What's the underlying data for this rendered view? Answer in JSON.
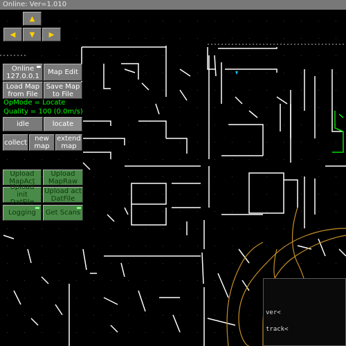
{
  "title_bar": {
    "text": "Online: Ver=1.010"
  },
  "arrows": {
    "up": "▲",
    "left": "◀",
    "down": "▼",
    "right": "▶"
  },
  "online": {
    "line1": "Online",
    "line2": "127.0.0.1"
  },
  "buttons": {
    "map_edit": "Map Edit",
    "load_map": [
      "Load Map",
      "from File"
    ],
    "save_map": [
      "Save Map",
      "to File"
    ],
    "idle": "idle",
    "locate": "locate",
    "collect": "collect",
    "new_map": [
      "new",
      "map"
    ],
    "extend_map": [
      "extend",
      "map"
    ],
    "upload_mapact": [
      "Upload",
      "MapAct"
    ],
    "upload_mapraw": [
      "Upload",
      "MapRaw"
    ],
    "upload_init": [
      "Upload init",
      "DatFile"
    ],
    "upload_act": [
      "Upload act",
      "DatFile"
    ],
    "logging": "Logging",
    "get_scans": "Get Scans"
  },
  "status": {
    "opmode": "OpMode = Locate",
    "quality": "Quality = 100 (0.0m/s)"
  },
  "console": {
    "line1": "ver<",
    "line2": "track<"
  },
  "colors": {
    "background": "#000000",
    "title_bar": "#787878",
    "button": "#7a7a7a",
    "green_button": "#4a8a48",
    "status_text": "#00ff00",
    "map_walls": "#ffffff",
    "trajectory": "#c8902a",
    "robot_marker": "#00c8ff"
  }
}
